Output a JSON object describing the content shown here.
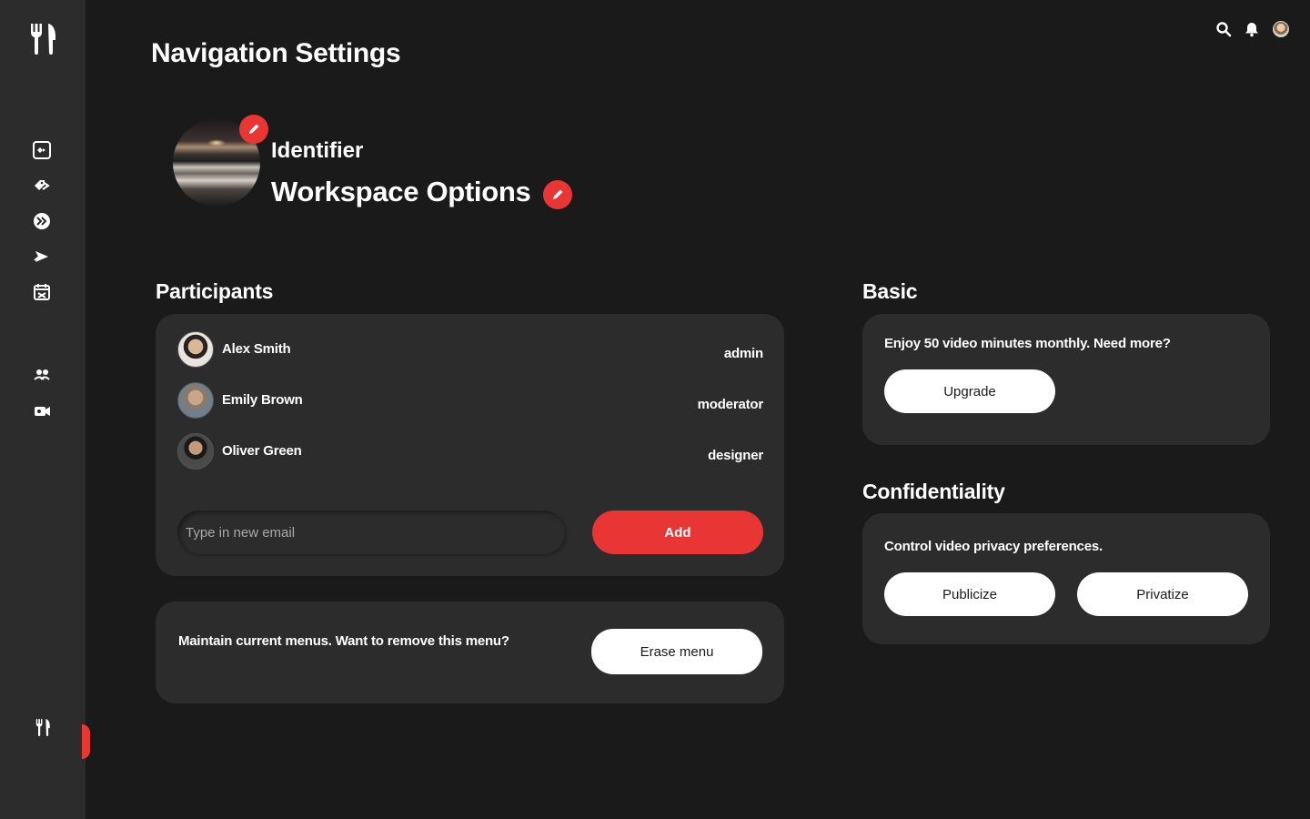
{
  "header": {
    "title": "Navigation Settings"
  },
  "profile": {
    "label": "Identifier",
    "name": "Workspace Options"
  },
  "participants": {
    "title": "Participants",
    "items": [
      {
        "name": "Alex Smith",
        "role": "admin"
      },
      {
        "name": "Emily Brown",
        "role": "moderator"
      },
      {
        "name": "Oliver Green",
        "role": "designer"
      }
    ],
    "email_placeholder": "Type in new email",
    "add_label": "Add"
  },
  "danger": {
    "text": "Maintain current menus. Want to remove this menu?",
    "erase_label": "Erase menu"
  },
  "basic": {
    "title": "Basic",
    "text": "Enjoy 50 video minutes monthly. Need more?",
    "upgrade_label": "Upgrade"
  },
  "confidentiality": {
    "title": "Confidentiality",
    "text": "Control video privacy preferences.",
    "publicize_label": "Publicize",
    "privatize_label": "Privatize"
  },
  "icons": {
    "logo": "fork-knife-icon",
    "nav": [
      "dashboard-icon",
      "tag-icon",
      "forward-icon",
      "plane-icon",
      "calendar-icon",
      "team-icon",
      "camera-icon"
    ],
    "topbar": [
      "search-icon",
      "bell-icon",
      "avatar"
    ]
  },
  "colors": {
    "accent": "#ea3535",
    "background": "#1b1a1b",
    "surface": "#2d2c2d"
  }
}
